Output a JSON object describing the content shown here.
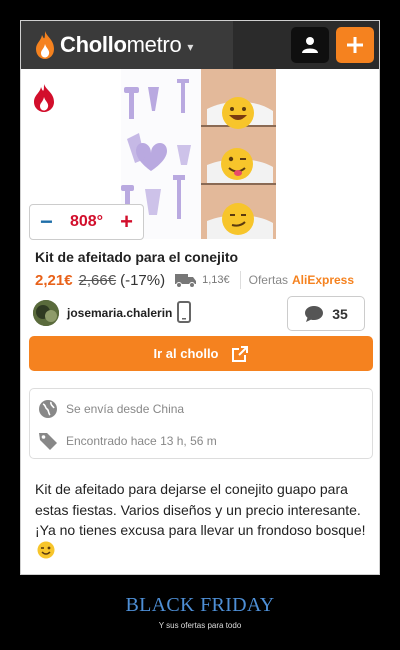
{
  "header": {
    "brand_bold": "Chollo",
    "brand_light": "metro",
    "caret": "▾"
  },
  "deal": {
    "temperature": "808°",
    "title": "Kit de afeitado para el conejito",
    "price": "2,21€",
    "old_price": "2,66€",
    "discount": "(-17%)",
    "shipping": "1,13€",
    "offers_label": "Ofertas",
    "merchant": "AliExpress",
    "username": "josemaria.chalerin",
    "comments": "35",
    "cta": "Ir al chollo",
    "ships_from": "Se envía desde China",
    "found": "Encontrado hace 13 h, 56 m",
    "description": "Kit de afeitado para dejarse el conejito guapo para estas fiestas. Varios diseños y un precio interesante. ¡Ya no tienes excusa para llevar un frondoso bosque!"
  },
  "poster": {
    "title": "BLACK FRIDAY",
    "subtitle": "Y sus ofertas para todo"
  },
  "colors": {
    "accent": "#f5821f",
    "hot": "#d20e2b",
    "header_bg": "#2b2b2b",
    "poster_title": "#4e8fd6"
  },
  "icons": [
    "flame-logo-icon",
    "user-icon",
    "plus-icon",
    "hot-flame-icon",
    "truck-icon",
    "phone-icon",
    "comment-icon",
    "external-link-icon",
    "globe-icon",
    "tag-icon"
  ]
}
